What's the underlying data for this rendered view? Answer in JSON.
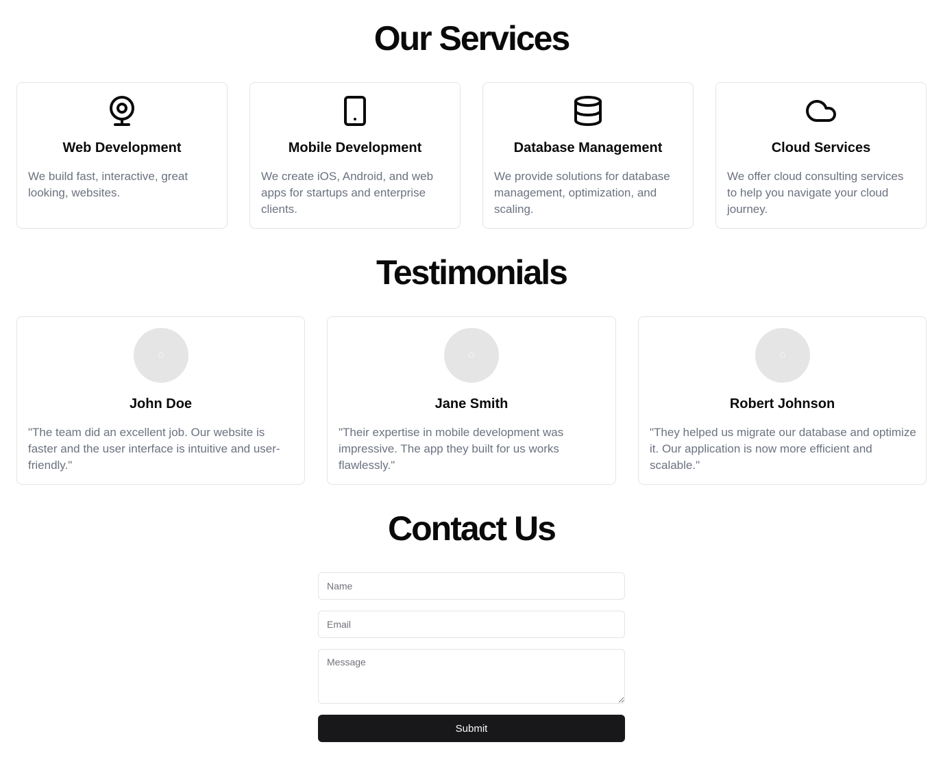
{
  "services": {
    "title": "Our Services",
    "items": [
      {
        "icon": "webcam-icon",
        "title": "Web Development",
        "description": "We build fast, interactive, great looking, websites."
      },
      {
        "icon": "tablet-icon",
        "title": "Mobile Development",
        "description": "We create iOS, Android, and web apps for startups and enterprise clients."
      },
      {
        "icon": "database-icon",
        "title": "Database Management",
        "description": "We provide solutions for database management, optimization, and scaling."
      },
      {
        "icon": "cloud-icon",
        "title": "Cloud Services",
        "description": "We offer cloud consulting services to help you navigate your cloud journey."
      }
    ]
  },
  "testimonials": {
    "title": "Testimonials",
    "items": [
      {
        "name": "John Doe",
        "quote": "\"The team did an excellent job. Our website is faster and the user interface is intuitive and user-friendly.\""
      },
      {
        "name": "Jane Smith",
        "quote": "\"Their expertise in mobile development was impressive. The app they built for us works flawlessly.\""
      },
      {
        "name": "Robert Johnson",
        "quote": "\"They helped us migrate our database and optimize it. Our application is now more efficient and scalable.\""
      }
    ]
  },
  "contact": {
    "title": "Contact Us",
    "name_placeholder": "Name",
    "email_placeholder": "Email",
    "message_placeholder": "Message",
    "submit_label": "Submit"
  }
}
